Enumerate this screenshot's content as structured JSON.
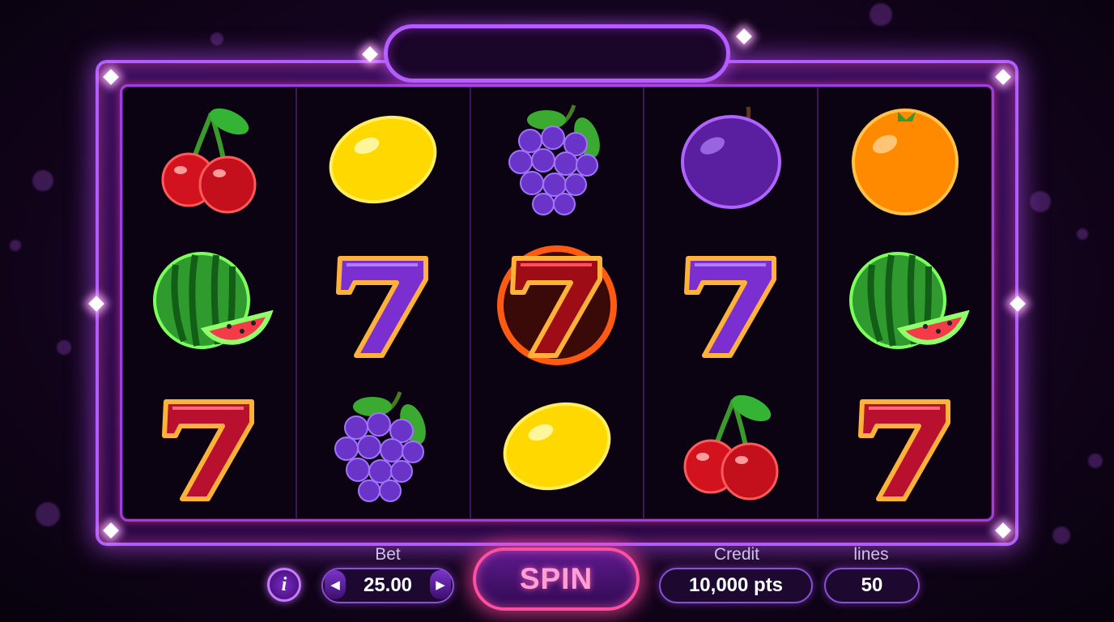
{
  "reels": [
    [
      "cherry-icon",
      "watermelon-icon",
      "red-seven-icon"
    ],
    [
      "lemon-icon",
      "purple-seven-icon",
      "grapes-icon"
    ],
    [
      "grapes-icon",
      "flaming-seven-icon",
      "lemon-icon"
    ],
    [
      "plum-icon",
      "purple-seven-icon",
      "cherry-icon"
    ],
    [
      "orange-icon",
      "watermelon-icon",
      "red-seven-icon"
    ]
  ],
  "bet": {
    "label": "Bet",
    "value": "25.00"
  },
  "spin": {
    "label": "SPIN"
  },
  "credit": {
    "label": "Credit",
    "value": "10,000 pts"
  },
  "lines": {
    "label": "lines",
    "value": "50"
  },
  "info": {
    "label": "i"
  },
  "colors": {
    "accent": "#b25cff",
    "spin_border": "#ff4fa0",
    "background": "#14041f"
  }
}
